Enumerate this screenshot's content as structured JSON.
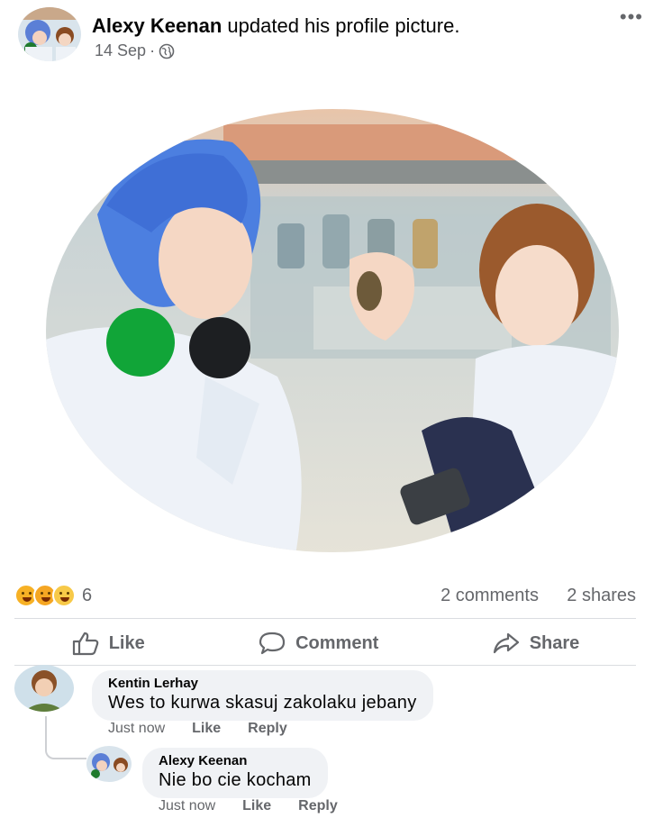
{
  "post": {
    "author": "Alexy Keenan",
    "action": "updated his profile picture.",
    "date": "14 Sep",
    "separator": "·",
    "audience_icon": "globe-icon",
    "more_icon": "more-options-icon"
  },
  "stats": {
    "reaction_icons": [
      "haha-reaction-icon",
      "wow-reaction-icon",
      "sad-reaction-icon"
    ],
    "reaction_count": "6",
    "comments": "2 comments",
    "shares": "2 shares"
  },
  "actions": {
    "like": "Like",
    "comment": "Comment",
    "share": "Share"
  },
  "comments": [
    {
      "name": "Kentin Lerhay",
      "text": "Wes to kurwa skasuj zakolaku jebany",
      "time": "Just now",
      "like": "Like",
      "reply": "Reply"
    },
    {
      "name": "Alexy Keenan",
      "text": "Nie bo cie kocham",
      "time": "Just now",
      "like": "Like",
      "reply": "Reply"
    }
  ],
  "colors": {
    "text_primary": "#050505",
    "text_secondary": "#65676b",
    "bubble_bg": "#f0f2f5",
    "divider": "#dadde1"
  }
}
